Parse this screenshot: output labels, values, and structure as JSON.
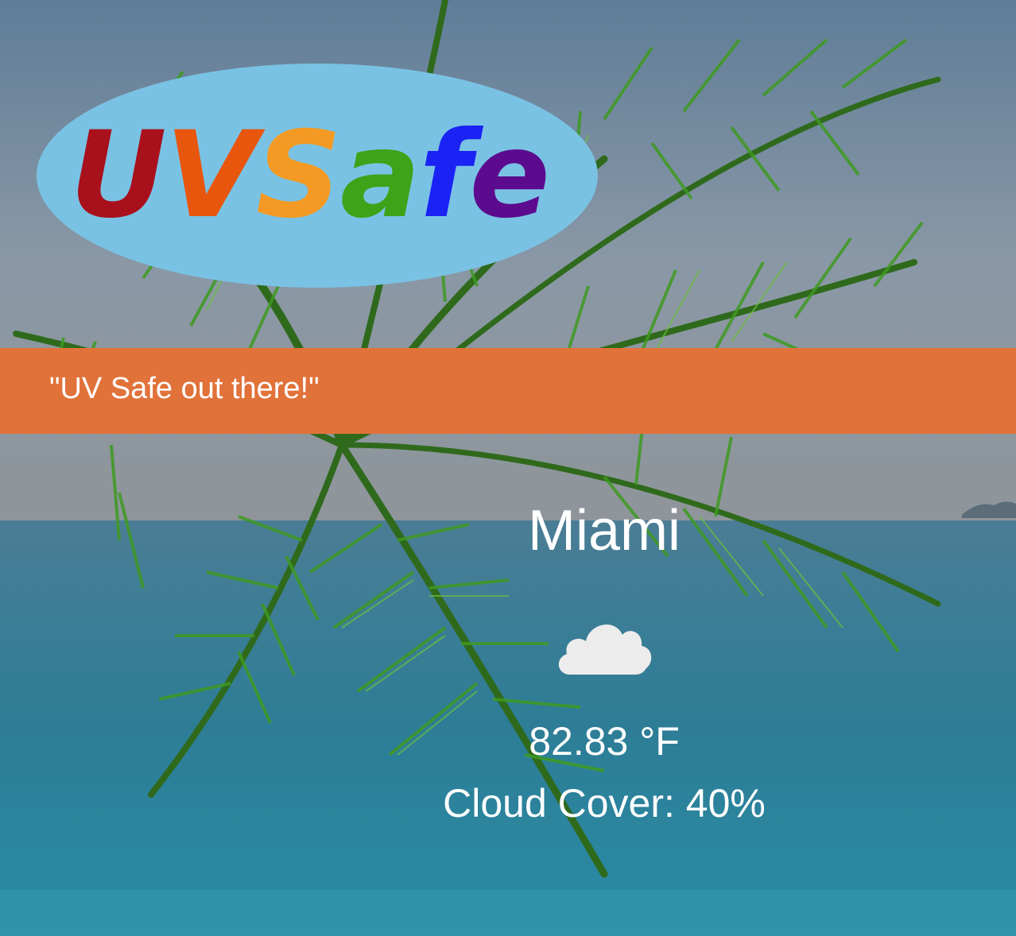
{
  "logo": {
    "letters": [
      {
        "char": "U",
        "color": "#a8101c"
      },
      {
        "char": "V",
        "color": "#e8560e"
      },
      {
        "char": "S",
        "color": "#f49a24"
      },
      {
        "char": "a",
        "color": "#3ea318"
      },
      {
        "char": "f",
        "color": "#1a22f4"
      },
      {
        "char": "e",
        "color": "#5c0b8e"
      }
    ],
    "ellipse_color": "#7ac2e4"
  },
  "banner": {
    "tagline": "\"UV Safe out there!\"",
    "color": "#e1723a"
  },
  "weather": {
    "city": "Miami",
    "condition_icon": "cloud-icon",
    "temperature": "82.83 °F",
    "cloud_cover": "Cloud Cover: 40%"
  }
}
